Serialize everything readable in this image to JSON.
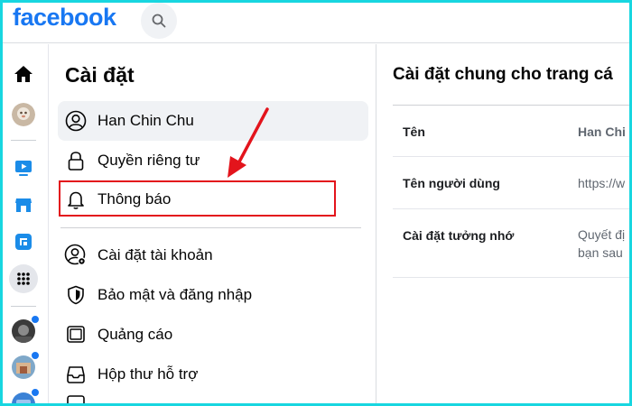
{
  "header": {
    "logo": "facebook",
    "search_icon": "search-icon"
  },
  "rail": {
    "icons": [
      "home-icon",
      "profile-avatar",
      "watch-icon",
      "marketplace-icon",
      "gaming-icon",
      "apps-grid-icon",
      "group-avatar-1",
      "group-avatar-2",
      "group-avatar-3"
    ],
    "accent": "#1877f2"
  },
  "settings": {
    "title": "Cài đặt",
    "items": [
      {
        "label": "Han Chin Chu",
        "icon": "user-circle-icon"
      },
      {
        "label": "Quyền riêng tư",
        "icon": "lock-icon"
      },
      {
        "label": "Thông báo",
        "icon": "bell-icon"
      },
      {
        "label": "Cài đặt tài khoản",
        "icon": "user-gear-icon"
      },
      {
        "label": "Bảo mật và đăng nhập",
        "icon": "shield-icon"
      },
      {
        "label": "Quảng cáo",
        "icon": "ad-screen-icon"
      },
      {
        "label": "Hộp thư hỗ trợ",
        "icon": "inbox-icon"
      }
    ]
  },
  "main": {
    "title": "Cài đặt chung cho trang cá",
    "rows": [
      {
        "label": "Tên",
        "value": "Han Chi"
      },
      {
        "label": "Tên người dùng",
        "value": "https://w"
      },
      {
        "label": "Cài đặt tưởng nhớ",
        "value_line1": "Quyết đị",
        "value_line2": "bạn sau"
      }
    ]
  },
  "colors": {
    "brand": "#1877f2",
    "highlight": "#e3141c",
    "frame": "#18d6e0"
  }
}
